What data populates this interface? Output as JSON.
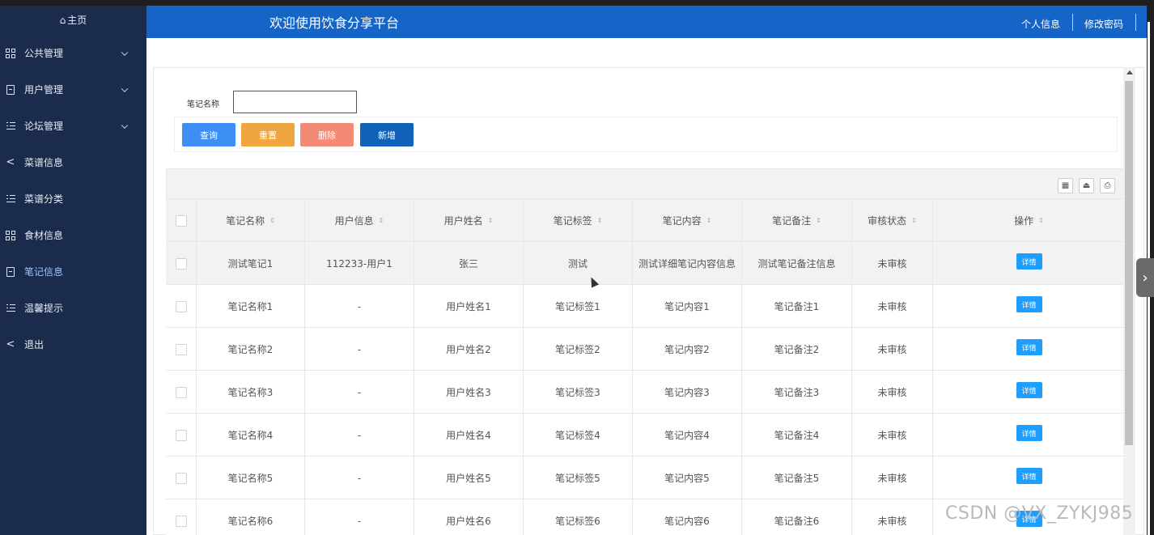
{
  "sidebar": {
    "home_label": "主页",
    "items": [
      {
        "label": "公共管理",
        "icon": "grid-icon",
        "has_arrow": true
      },
      {
        "label": "用户管理",
        "icon": "book-icon",
        "has_arrow": true
      },
      {
        "label": "论坛管理",
        "icon": "list-icon",
        "has_arrow": true
      },
      {
        "label": "菜谱信息",
        "icon": "share-icon",
        "has_arrow": false
      },
      {
        "label": "菜谱分类",
        "icon": "list-icon",
        "has_arrow": false
      },
      {
        "label": "食材信息",
        "icon": "grid-icon",
        "has_arrow": false
      },
      {
        "label": "笔记信息",
        "icon": "book-icon",
        "has_arrow": false,
        "active": true
      },
      {
        "label": "温馨提示",
        "icon": "list-icon",
        "has_arrow": false
      },
      {
        "label": "退出",
        "icon": "share-icon",
        "has_arrow": false
      }
    ]
  },
  "header": {
    "title": "欢迎使用饮食分享平台",
    "profile_link": "个人信息",
    "password_link": "修改密码"
  },
  "search": {
    "label": "笔记名称",
    "value": ""
  },
  "buttons": {
    "query": "查询",
    "reset": "重置",
    "delete": "删除",
    "add": "新增"
  },
  "colors": {
    "sidebar_bg": "#1b2b4b",
    "header_bg": "#1565c9",
    "query_btn": "#3d8ff6",
    "reset_btn": "#f0a640",
    "delete_btn": "#f28a75",
    "add_btn": "#0f62b8",
    "detail_btn": "#1e9fff"
  },
  "table": {
    "columns": [
      "笔记名称",
      "用户信息",
      "用户姓名",
      "笔记标签",
      "笔记内容",
      "笔记备注",
      "审核状态",
      "操作"
    ],
    "action_label": "详情",
    "rows": [
      [
        "测试笔记1",
        "112233-用户1",
        "张三",
        "测试",
        "测试详细笔记内容信息",
        "测试笔记备注信息",
        "未审核"
      ],
      [
        "笔记名称1",
        "-",
        "用户姓名1",
        "笔记标签1",
        "笔记内容1",
        "笔记备注1",
        "未审核"
      ],
      [
        "笔记名称2",
        "-",
        "用户姓名2",
        "笔记标签2",
        "笔记内容2",
        "笔记备注2",
        "未审核"
      ],
      [
        "笔记名称3",
        "-",
        "用户姓名3",
        "笔记标签3",
        "笔记内容3",
        "笔记备注3",
        "未审核"
      ],
      [
        "笔记名称4",
        "-",
        "用户姓名4",
        "笔记标签4",
        "笔记内容4",
        "笔记备注4",
        "未审核"
      ],
      [
        "笔记名称5",
        "-",
        "用户姓名5",
        "笔记标签5",
        "笔记内容5",
        "笔记备注5",
        "未审核"
      ],
      [
        "笔记名称6",
        "-",
        "用户姓名6",
        "笔记标签6",
        "笔记内容6",
        "笔记备注6",
        "未审核"
      ]
    ]
  },
  "watermark": "CSDN @VX_ZYKJ985"
}
